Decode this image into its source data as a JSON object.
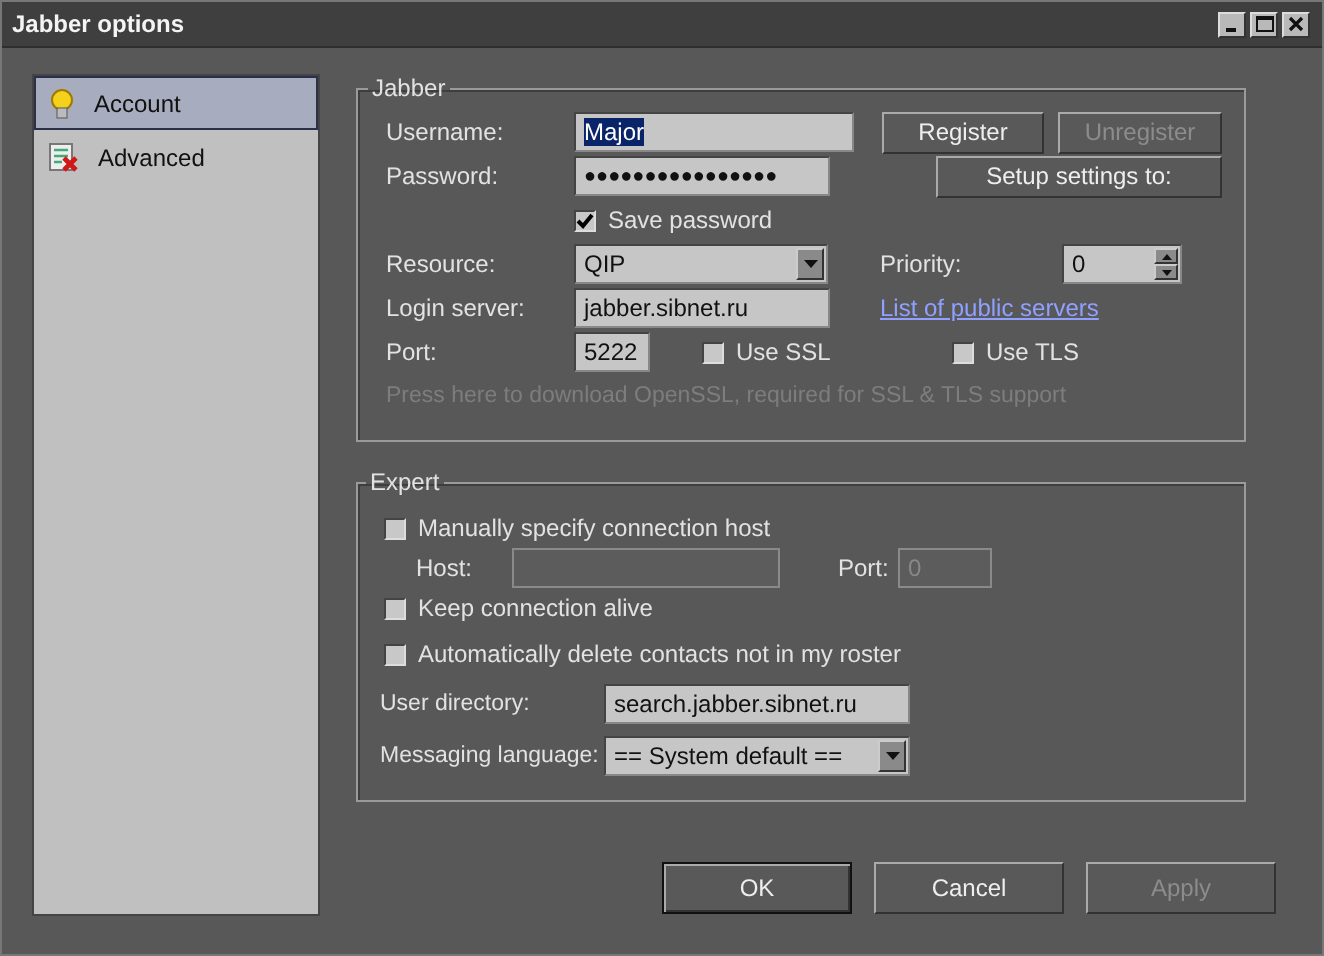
{
  "window": {
    "title": "Jabber options"
  },
  "sidebar": {
    "items": [
      {
        "label": "Account",
        "selected": true
      },
      {
        "label": "Advanced",
        "selected": false
      }
    ]
  },
  "jabber": {
    "title": "Jabber",
    "username": {
      "label": "Username:",
      "value": "Major",
      "text_selected": true
    },
    "password": {
      "label": "Password:",
      "value": "●●●●●●●●●●●●●●●●"
    },
    "register": {
      "label": "Register",
      "disabled": false
    },
    "unregister": {
      "label": "Unregister",
      "disabled": true
    },
    "setup": {
      "label": "Setup settings to:",
      "disabled": false
    },
    "save_password": {
      "label": "Save password",
      "checked": true
    },
    "resource": {
      "label": "Resource:",
      "value": "QIP"
    },
    "priority": {
      "label": "Priority:",
      "value": "0"
    },
    "login_server": {
      "label": "Login server:",
      "value": "jabber.sibnet.ru"
    },
    "public_servers_link": "List of public servers",
    "port": {
      "label": "Port:",
      "value": "5222"
    },
    "use_ssl": {
      "label": "Use SSL",
      "checked": false
    },
    "use_tls": {
      "label": "Use TLS",
      "checked": false
    },
    "openssl_hint": {
      "text": "Press here to download OpenSSL, required for SSL & TLS support",
      "disabled": true
    }
  },
  "expert": {
    "title": "Expert",
    "manual_host": {
      "label": "Manually specify connection host",
      "checked": false
    },
    "host": {
      "label": "Host:",
      "disabled": true
    },
    "host_port": {
      "label": "Port:",
      "value": "0",
      "disabled": true
    },
    "keep_alive": {
      "label": "Keep connection alive",
      "checked": false
    },
    "auto_delete": {
      "label": "Automatically delete contacts not in my roster",
      "checked": false
    },
    "user_directory": {
      "label": "User directory:",
      "value": "search.jabber.sibnet.ru"
    },
    "messaging_language": {
      "label": "Messaging language:",
      "value": "== System default =="
    }
  },
  "dialog_buttons": [
    {
      "label": "OK",
      "disabled": false,
      "focused": true
    },
    {
      "label": "Cancel",
      "disabled": false,
      "focused": false
    },
    {
      "label": "Apply",
      "disabled": true,
      "focused": false
    }
  ]
}
